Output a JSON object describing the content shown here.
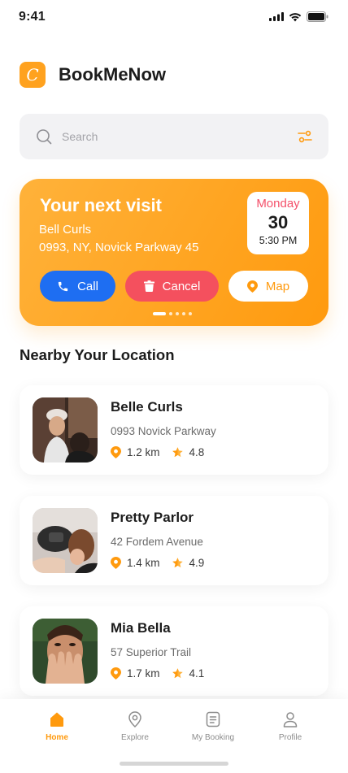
{
  "status_bar": {
    "time": "9:41"
  },
  "header": {
    "logo_letter": "C",
    "app_name": "BookMeNow"
  },
  "search": {
    "placeholder": "Search"
  },
  "next_visit": {
    "title": "Your next visit",
    "salon_name": "Bell Curls",
    "address": "0993, NY, Novick Parkway 45",
    "date": {
      "day": "Monday",
      "number": "30",
      "time": "5:30 PM"
    },
    "buttons": {
      "call": "Call",
      "cancel": "Cancel",
      "map": "Map"
    }
  },
  "nearby": {
    "title": "Nearby Your Location",
    "items": [
      {
        "name": "Belle Curls",
        "address": "0993 Novick Parkway",
        "distance": "1.2 km",
        "rating": "4.8"
      },
      {
        "name": "Pretty Parlor",
        "address": "42 Fordem Avenue",
        "distance": "1.4 km",
        "rating": "4.9"
      },
      {
        "name": "Mia Bella",
        "address": "57 Superior Trail",
        "distance": "1.7 km",
        "rating": "4.1"
      }
    ]
  },
  "tabs": [
    {
      "label": "Home",
      "icon": "home-icon",
      "active": true
    },
    {
      "label": "Explore",
      "icon": "location-pin-icon",
      "active": false
    },
    {
      "label": "My Booking",
      "icon": "booking-list-icon",
      "active": false
    },
    {
      "label": "Profile",
      "icon": "user-icon",
      "active": false
    }
  ],
  "colors": {
    "accent": "#ff9a0e",
    "call": "#1e6ef2",
    "cancel": "#f4505e",
    "date_day": "#f4506a"
  }
}
